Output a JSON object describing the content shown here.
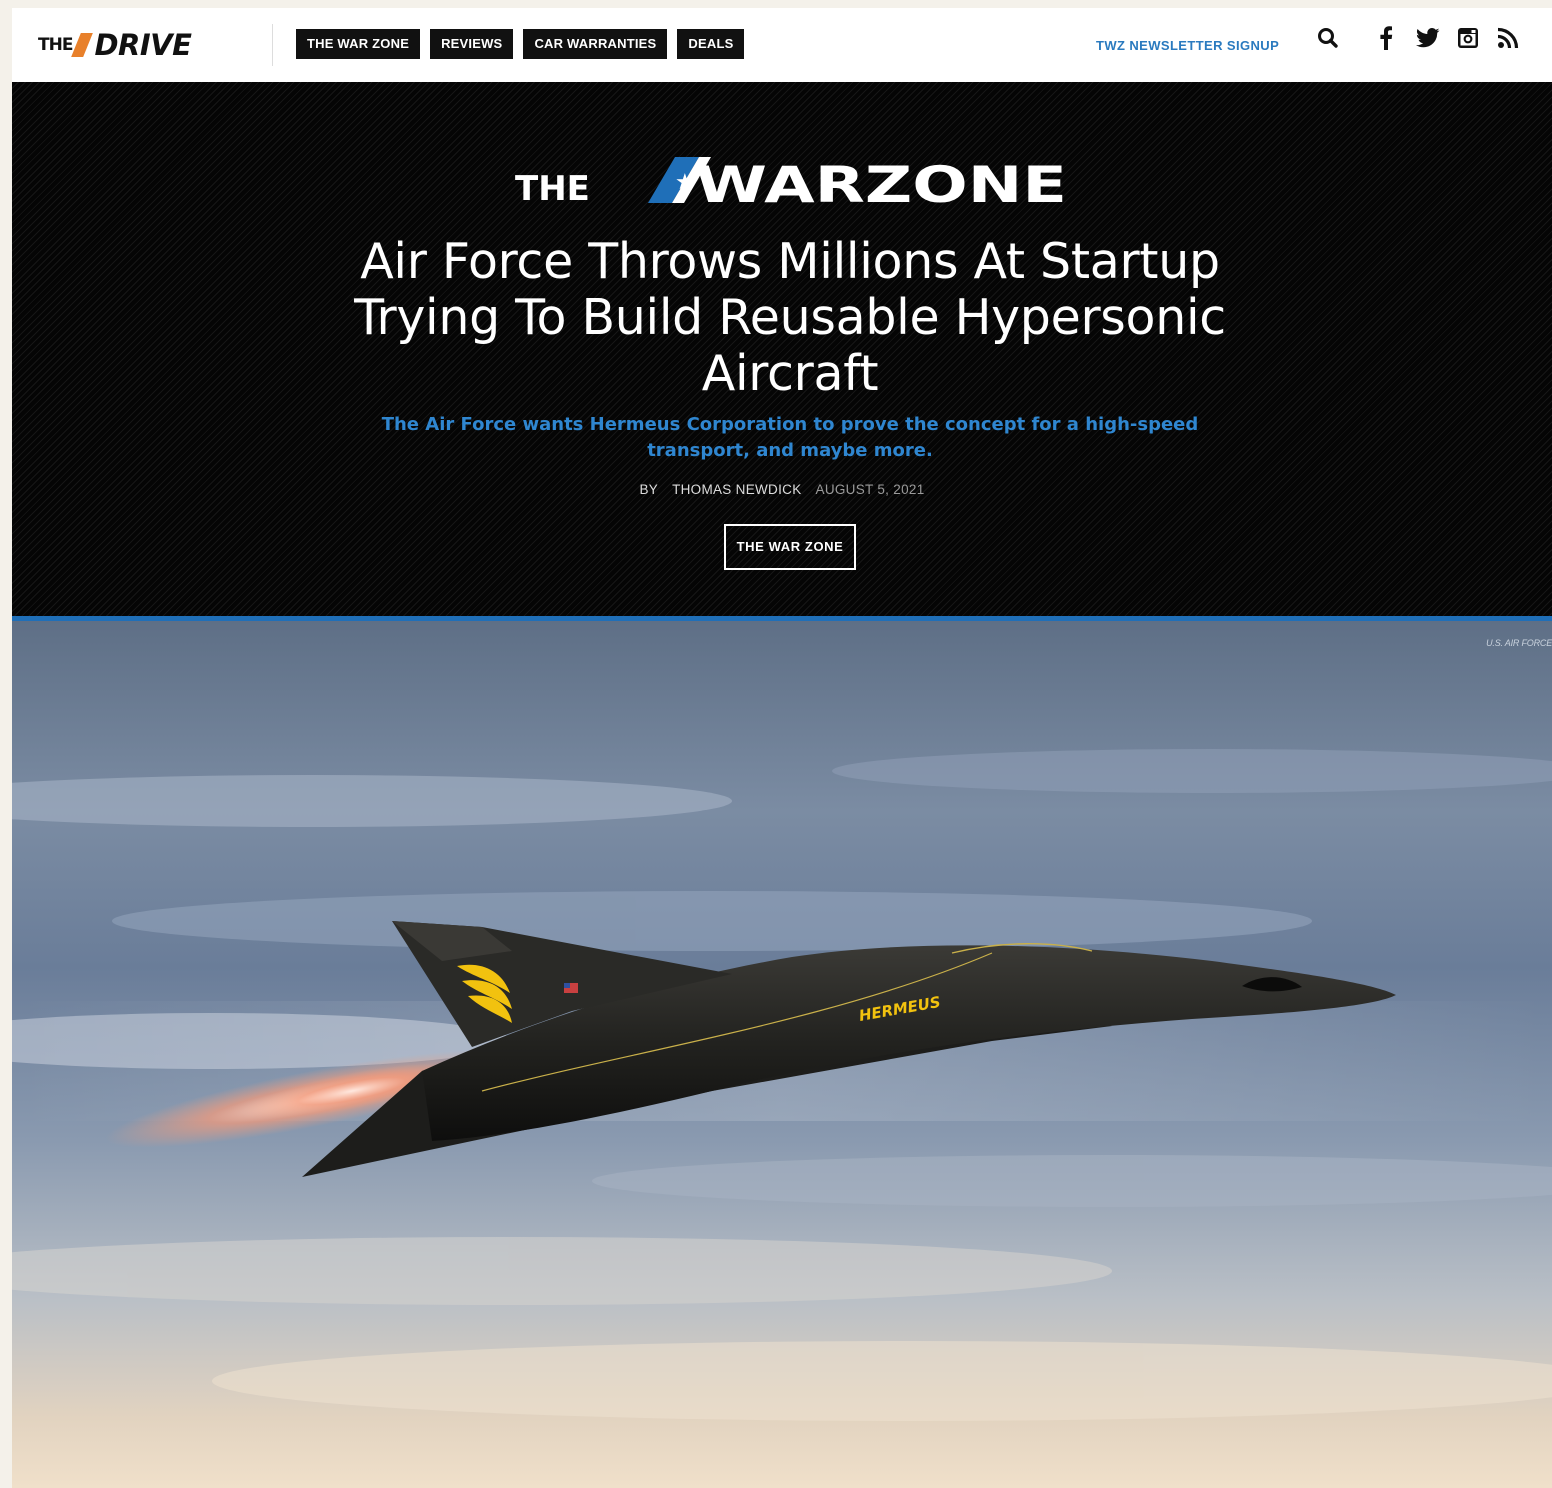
{
  "header": {
    "logo": {
      "the": "THE",
      "drive": "DRIVE"
    },
    "nav": [
      "THE WAR ZONE",
      "REVIEWS",
      "CAR WARRANTIES",
      "DEALS"
    ],
    "newsletter": "TWZ NEWSLETTER SIGNUP",
    "icons": [
      "search-icon",
      "facebook-icon",
      "twitter-icon",
      "instagram-icon",
      "rss-icon"
    ]
  },
  "hero": {
    "section_logo": {
      "the": "THE",
      "warzone": "WARZONE"
    },
    "headline": "Air Force Throws Millions At Startup Trying To Build Reusable Hypersonic Aircraft",
    "dek": "The Air Force wants Hermeus Corporation to prove the concept for a high-speed transport, and maybe more.",
    "byline": {
      "by": "BY",
      "author": "THOMAS NEWDICK",
      "date": "AUGUST 5, 2021"
    },
    "tag": "THE WAR ZONE"
  },
  "image": {
    "credit": "U.S. AIR FORCE",
    "aircraft_marking": "HERMEUS"
  },
  "colors": {
    "accent_blue": "#2f86d0",
    "drive_orange": "#e8802a",
    "hero_bg": "#0a0a0a"
  }
}
